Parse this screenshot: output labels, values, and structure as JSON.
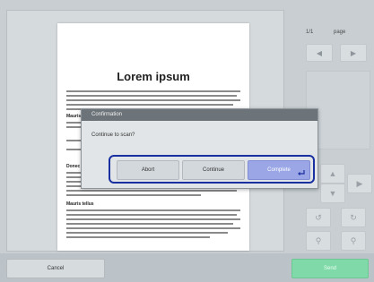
{
  "document": {
    "title": "Lorem ipsum",
    "headings": [
      "Mauris",
      "Donec",
      "Mauris tellus"
    ]
  },
  "right_panel": {
    "page_indicator": "1/1",
    "page_label": "page"
  },
  "dialog": {
    "title": "Confirmation",
    "message": "Continue to scan?",
    "buttons": {
      "abort": "Abort",
      "continue": "Continue",
      "complete": "Complete"
    }
  },
  "footer": {
    "cancel_label": "Cancel",
    "send_label": "Send"
  },
  "colors": {
    "background": "#c8ced2",
    "dialog_header": "#6c7479",
    "highlight_border": "#1a2fa0",
    "primary_button": "#9aa6e6",
    "send_button": "#7fd9a8"
  },
  "icons": {
    "prev": "triangle-left-icon",
    "next": "triangle-right-icon",
    "enter": "enter-icon"
  }
}
